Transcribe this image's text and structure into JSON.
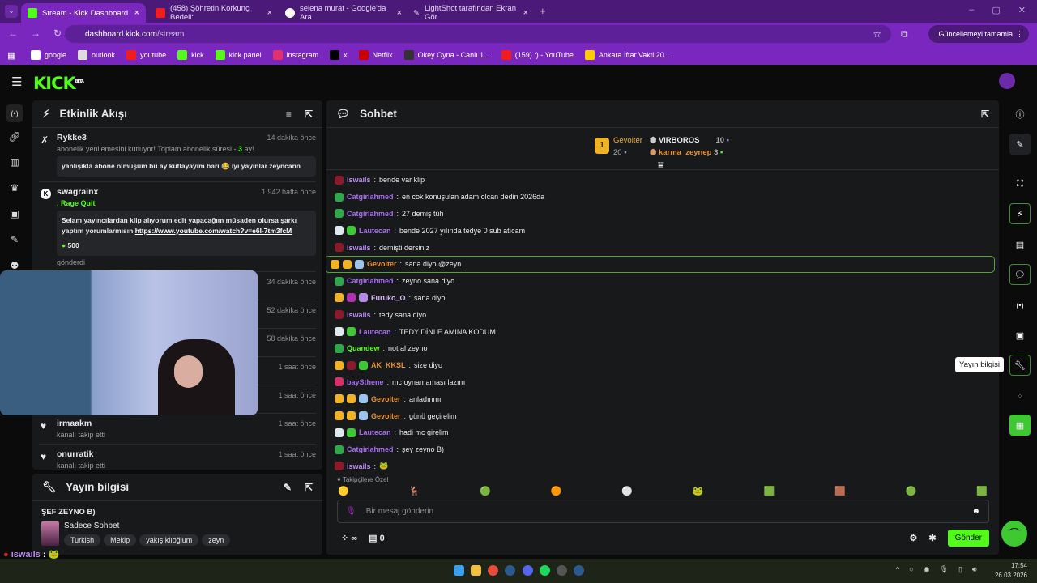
{
  "browser": {
    "tabs": [
      {
        "label": "Stream - Kick Dashboard",
        "active": true,
        "icon": "kick-icon"
      },
      {
        "label": "(458) Şöhretin Korkunç Bedeli:",
        "icon": "youtube-icon"
      },
      {
        "label": "selena murat - Google'da Ara",
        "icon": "google-icon"
      },
      {
        "label": "LightShot tarafından Ekran Gör",
        "icon": "feather-icon"
      }
    ],
    "url_host": "dashboard.kick.com",
    "url_path": "/stream",
    "profile_initial": "Z",
    "update_label": "Güncellemeyi tamamla",
    "bookmarks": [
      "google",
      "outlook",
      "youtube",
      "kick",
      "kick panel",
      "instagram",
      "x",
      "Netflix",
      "Okey Oyna - Canlı 1...",
      "(159) :) - YouTube",
      "Ankara İftar Vakti 20..."
    ]
  },
  "header": {
    "logo": "KICK",
    "beta": "BETA"
  },
  "activity": {
    "title": "Etkinlik Akışı",
    "items": [
      {
        "name": "Rykke3",
        "time": "14 dakika önce",
        "sub_pre": "abonelik yenilemesini kutluyor! Toplam abonelik süresi - ",
        "sub_num": "3",
        "sub_post": " ay!",
        "message": "yanlışıkla abone olmuşum bu ay kutlayayım bari 😂 iyi yayınlar zeyncann"
      },
      {
        "name": "swagrainx",
        "time": "1.942 hafta önce",
        "reward": "Rage Quit",
        "message": "Selam yayıncılardan klip alıyorum edit yapacağım müsaden olursa şarkı yaptım yorumlarmısın ",
        "link": "https://www.youtube.com/watch?v=e6l-7tm3fcM",
        "amount": "500",
        "footer": "gönderdi"
      }
    ],
    "hidden_times": [
      "34 dakika önce",
      "52 dakika önce",
      "58 dakika önce",
      "1 saat önce",
      "1 saat önce"
    ],
    "follows": [
      {
        "name": "irmaakm",
        "time": "1 saat önce",
        "sub": "kanalı takip etti"
      },
      {
        "name": "onurratik",
        "time": "1 saat önce",
        "sub": "kanalı takip etti"
      }
    ]
  },
  "stream_info": {
    "title": "Yayın bilgisi",
    "stream_title": "ŞEF ZEYNO B)",
    "category": "Sadece Sohbet",
    "tags": [
      "Turkish",
      "Mekip",
      "yakışıklıoğlum",
      "zeyn"
    ]
  },
  "chat": {
    "title": "Sohbet",
    "leaderboard": [
      {
        "rank": "1",
        "name": "Gevolter",
        "count": "20"
      },
      {
        "rank": "2",
        "name": "ViRBOROS",
        "count": "10"
      },
      {
        "rank": "3",
        "name": "karma_zeynep",
        "count": "3"
      }
    ],
    "messages": [
      {
        "user": "iswails",
        "text": "bende var klip",
        "color": "#b98cf0",
        "badges": [
          "#8b1a2a"
        ]
      },
      {
        "user": "Catgirlahmed",
        "text": "en cok konuşulan adam olcan dedin 2026da",
        "color": "#a66cf0",
        "badges": [
          "#2ea84a"
        ]
      },
      {
        "user": "Catgirlahmed",
        "text": "27 demiş tüh",
        "color": "#a66cf0",
        "badges": [
          "#2ea84a"
        ]
      },
      {
        "user": "Lautecan",
        "text": "bende 2027 yılında tedye 0 sub atıcam",
        "color": "#a66cf0",
        "badges": [
          "#dfe8ec",
          "#3ec832"
        ]
      },
      {
        "user": "iswails",
        "text": "demişti dersiniz",
        "color": "#b98cf0",
        "badges": [
          "#8b1a2a"
        ]
      },
      {
        "user": "Gevolter",
        "text": "sana diyo @zeyn",
        "color": "#e8912d",
        "badges": [
          "#f0b323",
          "#f0b323",
          "#9cc4ee"
        ],
        "highlight": true
      },
      {
        "user": "Catgirlahmed",
        "text": "zeyno sana diyo",
        "color": "#a66cf0",
        "badges": [
          "#2ea84a"
        ]
      },
      {
        "user": "Furuko_O",
        "text": "sana diyo",
        "color": "#d9b7f5",
        "badges": [
          "#f0b323",
          "#b030b0",
          "#b48ce8"
        ]
      },
      {
        "user": "iswails",
        "text": "tedy sana diyo",
        "color": "#b98cf0",
        "badges": [
          "#8b1a2a"
        ]
      },
      {
        "user": "Lautecan",
        "text": "TEDY DİNLE AMINA KODUM",
        "color": "#a66cf0",
        "badges": [
          "#dfe8ec",
          "#3ec832"
        ]
      },
      {
        "user": "Quandew",
        "text": "not al zeyno",
        "color": "#53fc18",
        "badges": [
          "#2ea84a"
        ]
      },
      {
        "user": "AK_KKSL",
        "text": "size diyo",
        "color": "#e8912d",
        "badges": [
          "#f0b323",
          "#8b1a2a",
          "#3ec832"
        ]
      },
      {
        "user": "baySthene",
        "text": "mc oynamaması lazım",
        "color": "#a66cf0",
        "badges": [
          "#d8306a"
        ]
      },
      {
        "user": "Gevolter",
        "text": "anladınmı",
        "color": "#e8912d",
        "badges": [
          "#f0b323",
          "#f0b323",
          "#9cc4ee"
        ]
      },
      {
        "user": "Gevolter",
        "text": "günü geçirelim",
        "color": "#e8912d",
        "badges": [
          "#f0b323",
          "#f0b323",
          "#9cc4ee"
        ]
      },
      {
        "user": "Lautecan",
        "text": "hadi mc girelim",
        "color": "#a66cf0",
        "badges": [
          "#dfe8ec",
          "#3ec832"
        ]
      },
      {
        "user": "Catgirlahmed",
        "text": "şey zeyno B)",
        "color": "#a66cf0",
        "badges": [
          "#2ea84a"
        ]
      },
      {
        "user": "iswails",
        "text": "🐸",
        "color": "#b98cf0",
        "badges": [
          "#8b1a2a"
        ]
      }
    ],
    "followers_only": "Takipçilere Özel",
    "input_placeholder": "Bir mesaj gönderin",
    "points": "∞",
    "gifts": "0",
    "send_label": "Gönder"
  },
  "right_sidebar": {
    "tooltip": "Yayın bilgisi"
  },
  "overlay_chat": {
    "user": "iswails",
    "sep": " :"
  },
  "taskbar": {
    "time": "17:54",
    "date": "26.03.2026"
  },
  "colors": {
    "accent": "#53fc18",
    "chrome_dark": "#4b1a78",
    "chrome": "#7a27c0",
    "panel": "#18191b"
  }
}
